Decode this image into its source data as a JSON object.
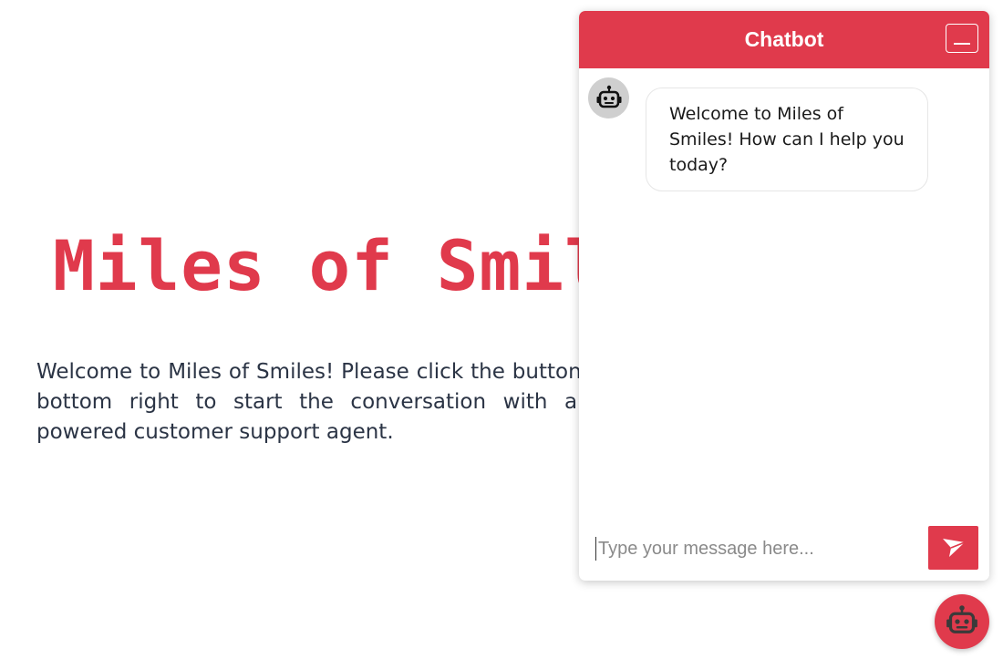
{
  "page": {
    "title": "Miles of Smiles",
    "intro": "Welcome to Miles of Smiles! Please click the button on the bottom right to start the conversation with an LLM-powered customer support agent."
  },
  "chat": {
    "header_title": "Chatbot",
    "minimize_icon": "minimize-icon",
    "bot_avatar_icon": "robot-icon",
    "messages": [
      {
        "sender": "bot",
        "text": "Welcome to Miles of Smiles! How can I help you today?"
      }
    ],
    "input": {
      "placeholder": "Type your message here...",
      "value": ""
    },
    "send_icon": "send-icon"
  },
  "launcher": {
    "icon": "robot-icon"
  },
  "colors": {
    "accent": "#e03a4c",
    "text": "#2b3445",
    "avatar_bg": "#cfcfcf"
  }
}
